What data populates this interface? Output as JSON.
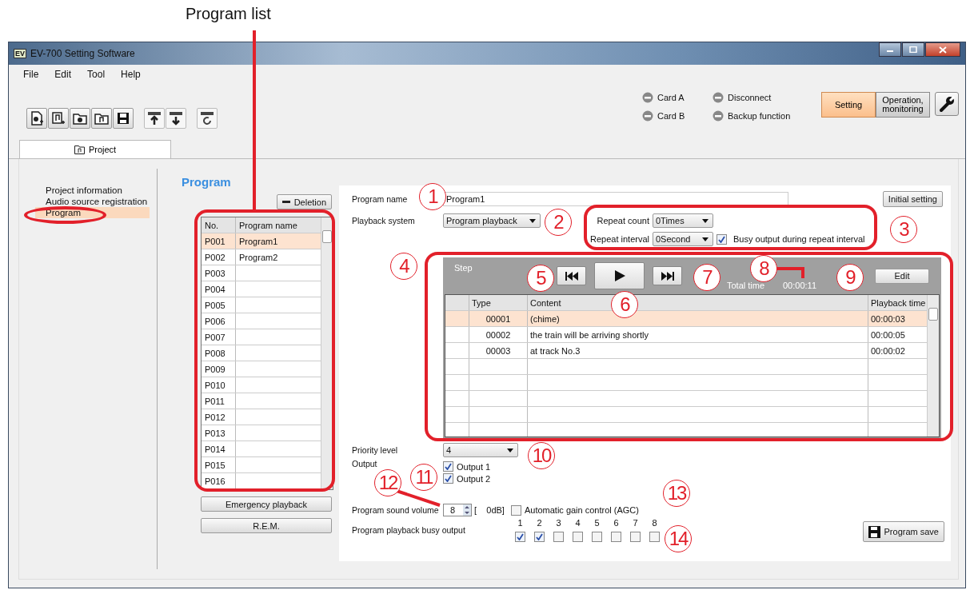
{
  "annotation_label": "Program list",
  "window": {
    "title": "EV-700 Setting Software",
    "icon_text": "EV"
  },
  "menu": [
    "File",
    "Edit",
    "Tool",
    "Help"
  ],
  "status": [
    {
      "label": "Card A"
    },
    {
      "label": "Disconnect"
    },
    {
      "label": "Card B"
    },
    {
      "label": "Backup function"
    }
  ],
  "mode_buttons": [
    {
      "label": "Setting",
      "selected": true
    },
    {
      "label": "Operation, monitoring",
      "selected": false
    }
  ],
  "tabs": [
    {
      "label": "Project",
      "selected": true
    }
  ],
  "nav": [
    {
      "label": "Project information",
      "selected": false
    },
    {
      "label": "Audio source registration",
      "selected": false
    },
    {
      "label": "Program",
      "selected": true
    }
  ],
  "section_title": "Program",
  "deletion_button": "Deletion",
  "program_list": {
    "columns": [
      "No.",
      "Program name"
    ],
    "rows": [
      {
        "no": "P001",
        "name": "Program1",
        "selected": true
      },
      {
        "no": "P002",
        "name": "Program2",
        "selected": false
      },
      {
        "no": "P003",
        "selected": false
      },
      {
        "no": "P004",
        "selected": false
      },
      {
        "no": "P005",
        "selected": false
      },
      {
        "no": "P006",
        "selected": false
      },
      {
        "no": "P007",
        "selected": false
      },
      {
        "no": "P008",
        "selected": false
      },
      {
        "no": "P009",
        "selected": false
      },
      {
        "no": "P010",
        "selected": false
      },
      {
        "no": "P011",
        "selected": false
      },
      {
        "no": "P012",
        "selected": false
      },
      {
        "no": "P013",
        "selected": false
      },
      {
        "no": "P014",
        "selected": false
      },
      {
        "no": "P015",
        "selected": false
      },
      {
        "no": "P016",
        "selected": false
      }
    ]
  },
  "list_buttons": [
    "Emergency playback",
    "R.E.M."
  ],
  "form": {
    "program_name": {
      "label": "Program name",
      "value": "Program1"
    },
    "initial_setting_button": "Initial setting",
    "playback_system": {
      "label": "Playback system",
      "value": "Program playback"
    },
    "repeat_count": {
      "label": "Repeat count",
      "value": "0Times"
    },
    "repeat_interval": {
      "label": "Repeat interval",
      "value": "0Second"
    },
    "busy_during_repeat": {
      "label": "Busy output during repeat interval",
      "checked": true
    },
    "step": {
      "label": "Step",
      "total_time_label": "Total time",
      "total_time": "00:00:11",
      "edit_button": "Edit",
      "columns": [
        "Type",
        "Content",
        "Playback time"
      ],
      "rows": [
        {
          "type": "00001",
          "content": "(chime)",
          "time": "00:00:03",
          "selected": true
        },
        {
          "type": "00002",
          "content": "the train will be arriving shortly",
          "time": "00:00:05",
          "selected": false
        },
        {
          "type": "00003",
          "content": "at track No.3",
          "time": "00:00:02",
          "selected": false
        }
      ]
    },
    "priority": {
      "label": "Priority level",
      "value": "4"
    },
    "output": {
      "label": "Output",
      "items": [
        {
          "label": "Output 1",
          "checked": true
        },
        {
          "label": "Output 2",
          "checked": true
        }
      ]
    },
    "volume": {
      "label": "Program sound volume",
      "value": "8",
      "db": "[    0dB]"
    },
    "agc": {
      "label": "Automatic gain control (AGC)",
      "checked": false
    },
    "busy_output": {
      "label": "Program playback busy output",
      "items": [
        {
          "number": "1",
          "checked": true
        },
        {
          "number": "2",
          "checked": true
        },
        {
          "number": "3",
          "checked": false
        },
        {
          "number": "4",
          "checked": false
        },
        {
          "number": "5",
          "checked": false
        },
        {
          "number": "6",
          "checked": false
        },
        {
          "number": "7",
          "checked": false
        },
        {
          "number": "8",
          "checked": false
        }
      ]
    },
    "save_button": "Program save"
  },
  "callouts": [
    "1",
    "2",
    "3",
    "4",
    "5",
    "6",
    "7",
    "8",
    "9",
    "10",
    "11",
    "12",
    "13",
    "14"
  ]
}
